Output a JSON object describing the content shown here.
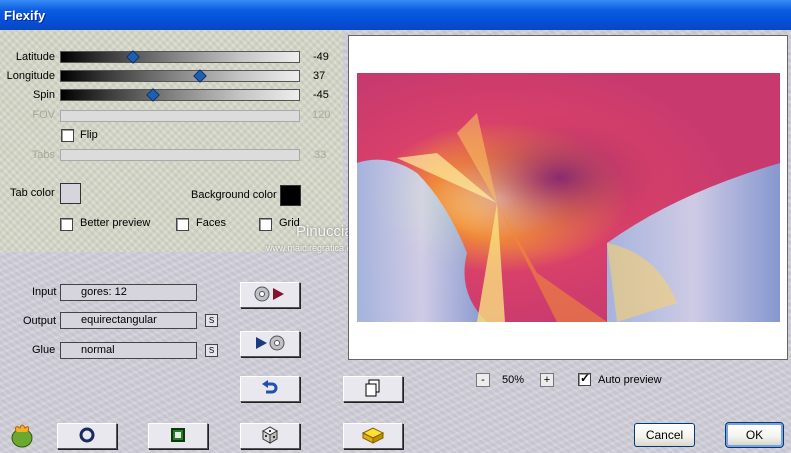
{
  "window": {
    "title": "Flexify"
  },
  "sliders": [
    {
      "label": "Latitude",
      "value": "-49",
      "level": 0.29,
      "enabled": true
    },
    {
      "label": "Longitude",
      "value": "37",
      "level": 0.59,
      "enabled": true
    },
    {
      "label": "Spin",
      "value": "-45",
      "level": 0.38,
      "enabled": true
    },
    {
      "label": "FOV",
      "value": "120",
      "level": 0,
      "enabled": false
    }
  ],
  "flip": {
    "label": "Flip",
    "checked": false
  },
  "tabs": {
    "label": "Tabs",
    "value": "33",
    "enabled": false
  },
  "colors": {
    "tab_color_label": "Tab color",
    "tab_color": "#d6d4dc",
    "background_color_label": "Background color",
    "background_color": "#000000"
  },
  "options": {
    "better_preview": {
      "label": "Better preview",
      "checked": false
    },
    "faces": {
      "label": "Faces",
      "checked": false
    },
    "grid": {
      "label": "Grid",
      "checked": false
    }
  },
  "watermark": {
    "line1": "Pinuccia",
    "line2": "www.maidiregrafica.eu"
  },
  "io": {
    "input": {
      "label": "Input",
      "value": "gores: 12"
    },
    "output": {
      "label": "Output",
      "value": "equirectangular",
      "button": "S"
    },
    "glue": {
      "label": "Glue",
      "value": "normal",
      "button": "S"
    }
  },
  "zoom": {
    "minus": "-",
    "value": "50%",
    "plus": "+"
  },
  "auto_preview": {
    "label": "Auto preview",
    "checked": true
  },
  "buttons": {
    "cancel": "Cancel",
    "ok": "OK"
  },
  "icons": {
    "input_to_output": "disc-play-icon",
    "output_to_input": "play-disc-icon",
    "undo": "undo-arrow-icon",
    "copy": "copy-document-icon",
    "logo": "flaming-pear-icon",
    "circle": "circle-icon",
    "square": "square-icon",
    "dice": "dice-icon",
    "block": "yellow-block-icon"
  },
  "accent": {
    "titlebar": "#0450d8",
    "thumb": "#1f5fb0"
  }
}
